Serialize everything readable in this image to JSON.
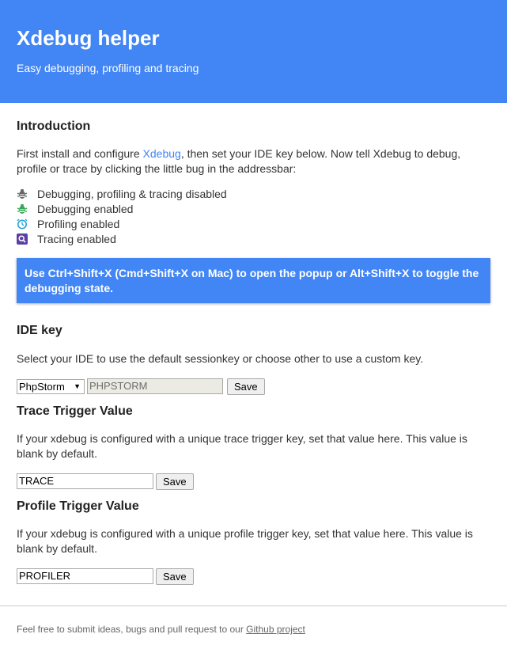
{
  "header": {
    "title": "Xdebug helper",
    "subtitle": "Easy debugging, profiling and tracing"
  },
  "intro": {
    "title": "Introduction",
    "text_before_link": "First install and configure ",
    "link_text": "Xdebug",
    "text_after_link": ", then set your IDE key below. Now tell Xdebug to debug, profile or trace by clicking the little bug in the addressbar:",
    "items": [
      {
        "icon": "bug-icon-gray",
        "label": "Debugging, profiling & tracing disabled"
      },
      {
        "icon": "bug-icon-green",
        "label": "Debugging enabled"
      },
      {
        "icon": "clock-icon",
        "label": "Profiling enabled"
      },
      {
        "icon": "magnifier-icon",
        "label": "Tracing enabled"
      }
    ],
    "shortcut_note": "Use Ctrl+Shift+X (Cmd+Shift+X on Mac) to open the popup or Alt+Shift+X to toggle the debugging state."
  },
  "ide": {
    "title": "IDE key",
    "text": "Select your IDE to use the default sessionkey or choose other to use a custom key.",
    "select_value": "PhpStorm",
    "key_value": "PHPSTORM",
    "save_label": "Save"
  },
  "trace": {
    "title": "Trace Trigger Value",
    "text": "If your xdebug is configured with a unique trace trigger key, set that value here. This value is blank by default.",
    "value": "TRACE",
    "save_label": "Save"
  },
  "profile": {
    "title": "Profile Trigger Value",
    "text": "If your xdebug is configured with a unique profile trigger key, set that value here. This value is blank by default.",
    "value": "PROFILER",
    "save_label": "Save"
  },
  "footer": {
    "text": "Feel free to submit ideas, bugs and pull request to our ",
    "link_text": "Github project"
  },
  "colors": {
    "accent": "#4285f4",
    "bug_gray": "#666666",
    "bug_green": "#34a853",
    "clock_blue": "#29a3d6",
    "magnifier_purple": "#5c3fa3"
  }
}
